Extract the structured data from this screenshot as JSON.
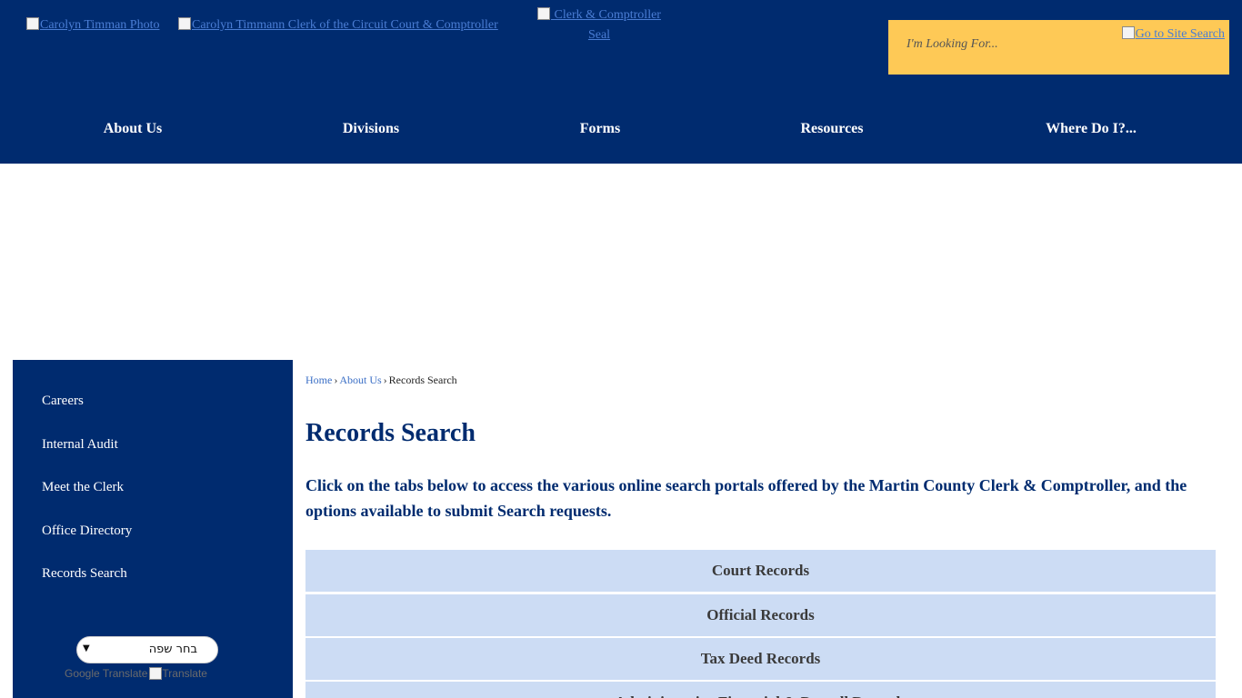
{
  "header": {
    "logo_photo_alt": "Carolyn Timman Photo",
    "logo_clerk_alt": "Carolyn Timmann Clerk of the Circuit Court & Comptroller",
    "logo_seal_alt": "Clerk & Comptroller Seal",
    "search": {
      "placeholder": "I'm Looking For...",
      "go_alt": "Go to Site Search"
    },
    "colors": {
      "nav_bg": "#002b6f",
      "search_bg": "#fec956"
    }
  },
  "nav": {
    "items": [
      {
        "label": "About Us"
      },
      {
        "label": "Divisions"
      },
      {
        "label": "Forms"
      },
      {
        "label": "Resources"
      },
      {
        "label": "Where Do I?..."
      }
    ]
  },
  "sidebar": {
    "items": [
      {
        "label": "Careers"
      },
      {
        "label": "Internal Audit"
      },
      {
        "label": "Meet the Clerk"
      },
      {
        "label": "Office Directory"
      },
      {
        "label": "Records Search"
      }
    ],
    "translate": {
      "select_value": "בחר שפה",
      "powered_by": "Google Translate",
      "translate_alt": "Translate"
    }
  },
  "breadcrumb": {
    "home": "Home",
    "about": "About Us",
    "current": "Records Search",
    "separator": "›"
  },
  "main": {
    "title": "Records Search",
    "intro": "Click on the tabs below to access the various online search portals offered by the Martin County Clerk & Comptroller, and the options available to submit Search requests.",
    "tabs": [
      {
        "label": "Court Records"
      },
      {
        "label": "Official Records"
      },
      {
        "label": "Tax Deed Records"
      },
      {
        "label": "Administrative Financial & Payroll Records"
      }
    ]
  }
}
